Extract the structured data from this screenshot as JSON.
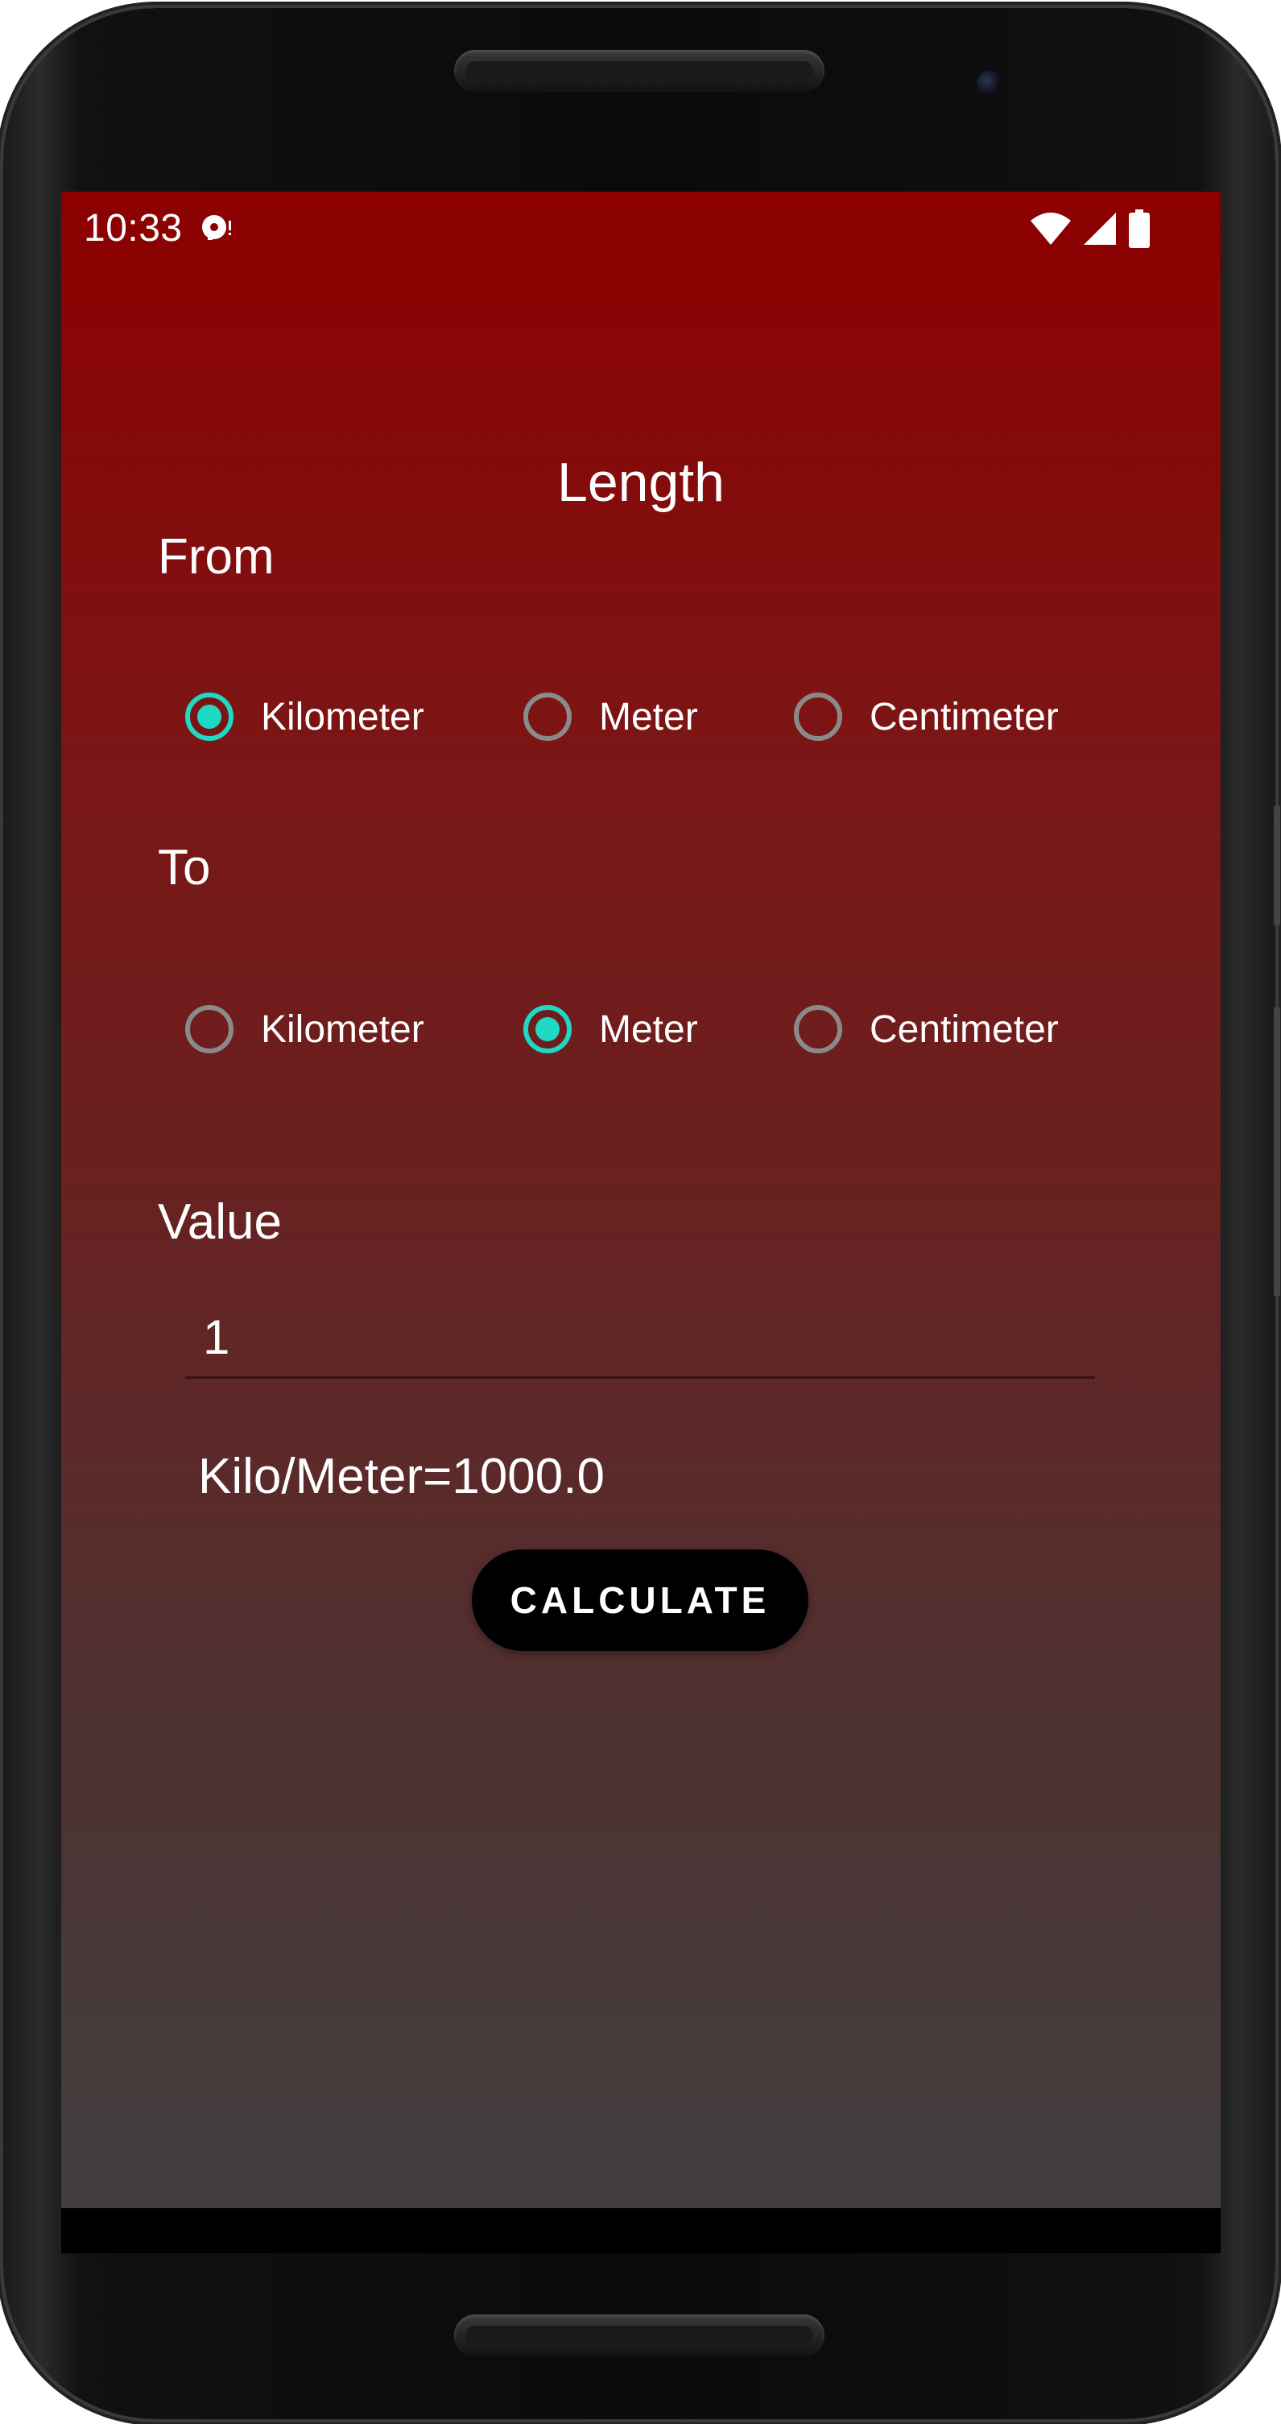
{
  "status_bar": {
    "time": "10:33",
    "icons": [
      "media-notification-icon",
      "wifi-icon",
      "signal-icon",
      "battery-icon"
    ]
  },
  "app": {
    "title": "Length",
    "from_label": "From",
    "to_label": "To",
    "value_label": "Value",
    "from_options": [
      {
        "label": "Kilometer",
        "checked": true
      },
      {
        "label": "Meter",
        "checked": false
      },
      {
        "label": "Centimeter",
        "checked": false
      }
    ],
    "to_options": [
      {
        "label": "Kilometer",
        "checked": false
      },
      {
        "label": "Meter",
        "checked": true
      },
      {
        "label": "Centimeter",
        "checked": false
      }
    ],
    "value_input": "1",
    "result_text": "Kilo/Meter=1000.0",
    "calculate_button": "CALCULATE"
  },
  "colors": {
    "accent": "#1fd9c4",
    "background_top": "#8d0000",
    "background_bottom": "#404040",
    "button": "#000000"
  }
}
